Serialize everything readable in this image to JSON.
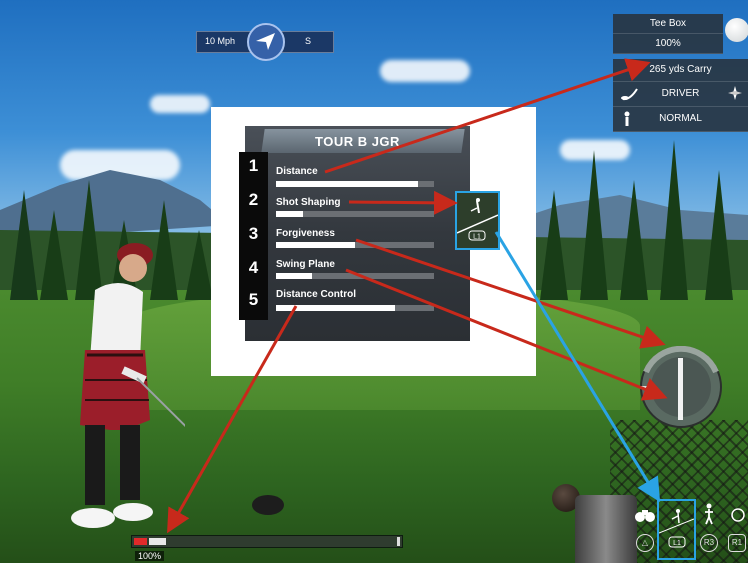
{
  "wind": {
    "speed": "10 Mph",
    "direction": "S",
    "icon": "wind-arrow-icon"
  },
  "hud": {
    "tee_box": "Tee Box",
    "tee_pct": "100%",
    "carry": "265 yds Carry",
    "club": "DRIVER",
    "lie": "NORMAL",
    "icons": [
      "golf-ball-icon",
      "club-icon",
      "compass-icon",
      "golfer-icon"
    ]
  },
  "inset": {
    "title": "TOUR B JGR",
    "attributes": [
      {
        "num": "1",
        "label": "Distance",
        "value": 0.9
      },
      {
        "num": "2",
        "label": "Shot Shaping",
        "value": 0.17
      },
      {
        "num": "3",
        "label": "Forgiveness",
        "value": 0.5
      },
      {
        "num": "4",
        "label": "Swing Plane",
        "value": 0.23
      },
      {
        "num": "5",
        "label": "Distance Control",
        "value": 0.75
      }
    ],
    "shot_shape_icon": "shot-shape-icon",
    "l1_label": "L1"
  },
  "power": {
    "label": "100%",
    "level": 0.1
  },
  "controls": {
    "binoculars": "binoculars-icon",
    "shot_shape": "shot-shape-icon",
    "golfer": "golfer-stance-icon",
    "putt": "putt-icon",
    "triangle": "△",
    "l1": "L1",
    "r3": "R3",
    "r1": "R1"
  },
  "colors": {
    "arrow_red": "#c8291b",
    "arrow_blue": "#2aa3e4",
    "panel_white": "#ffffff"
  }
}
